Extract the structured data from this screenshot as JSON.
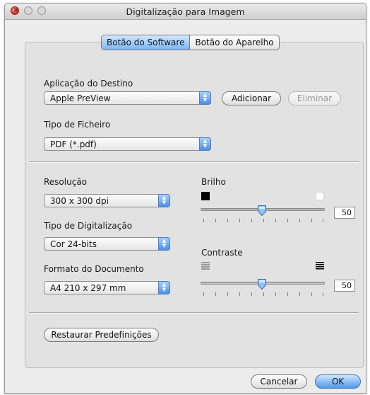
{
  "window": {
    "title": "Digitalização para Imagem"
  },
  "tabs": [
    {
      "label": "Botão do Software",
      "selected": true
    },
    {
      "label": "Botão do Aparelho",
      "selected": false
    }
  ],
  "destination": {
    "label": "Aplicação do Destino",
    "value": "Apple PreView",
    "add_label": "Adicionar",
    "remove_label": "Eliminar"
  },
  "file_type": {
    "label": "Tipo de Ficheiro",
    "value": "PDF (*.pdf)"
  },
  "resolution": {
    "label": "Resolução",
    "value": "300 x 300 dpi"
  },
  "scan_type": {
    "label": "Tipo de Digitalização",
    "value": "Cor 24-bits"
  },
  "document_size": {
    "label": "Formato do Documento",
    "value": "A4 210 x 297 mm"
  },
  "brightness": {
    "label": "Brilho",
    "value": "50"
  },
  "contrast": {
    "label": "Contraste",
    "value": "50"
  },
  "restore_label": "Restaurar Predefinições",
  "footer": {
    "cancel_label": "Cancelar",
    "ok_label": "OK"
  },
  "colors": {
    "accent": "#4f98ea",
    "panel": "#e2e2e2",
    "window": "#ececec"
  }
}
